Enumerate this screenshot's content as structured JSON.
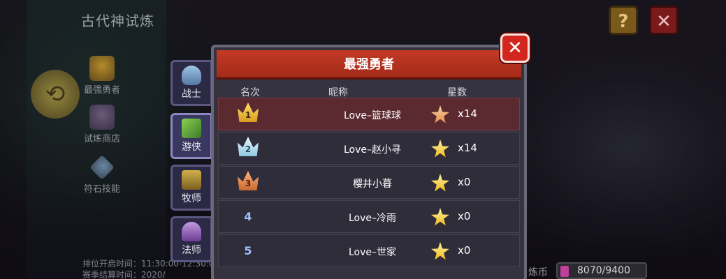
{
  "game": {
    "title": "古代神试炼"
  },
  "side_nav": {
    "items": [
      {
        "label": "最强勇者",
        "icon": "trophy-icon"
      },
      {
        "label": "试炼商店",
        "icon": "shop-icon"
      },
      {
        "label": "符石技能",
        "icon": "rune-icon"
      }
    ]
  },
  "footer": {
    "line1": "排位开启时间：11:30:00-12:30:0",
    "line2": "赛季结算时间：2020/"
  },
  "currency": {
    "label": "炼币",
    "value": "8070/9400"
  },
  "top_buttons": {
    "help": "?",
    "exit": "✕"
  },
  "class_tabs": [
    {
      "label": "战士",
      "icon": "warrior-icon",
      "active": false
    },
    {
      "label": "游侠",
      "icon": "ranger-icon",
      "active": true
    },
    {
      "label": "牧师",
      "icon": "priest-icon",
      "active": false
    },
    {
      "label": "法师",
      "icon": "mage-icon",
      "active": false
    }
  ],
  "panel": {
    "title": "最强勇者",
    "close": "✕",
    "columns": {
      "rank": "名次",
      "name": "昵称",
      "stars": "星数"
    }
  },
  "rows": [
    {
      "rank": "1",
      "name": "Love–篮球球",
      "stars": "x14",
      "crown": "gold"
    },
    {
      "rank": "2",
      "name": "Love–赵小寻",
      "stars": "x14",
      "crown": "silver"
    },
    {
      "rank": "3",
      "name": "樱井小暮",
      "stars": "x0",
      "crown": "bronze"
    },
    {
      "rank": "4",
      "name": "Love–冷雨",
      "stars": "x0",
      "crown": ""
    },
    {
      "rank": "5",
      "name": "Love–世家",
      "stars": "x0",
      "crown": ""
    }
  ],
  "colors": {
    "header_red": "#c33a24",
    "close_red": "#d3261e",
    "highlight_row": "#5a2a30",
    "star_gold": "#f2b81a"
  }
}
